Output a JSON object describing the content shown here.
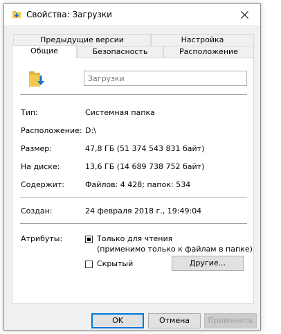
{
  "window": {
    "title": "Свойства: Загрузки",
    "accent_color": "#0078d7"
  },
  "tabs": {
    "row_top": [
      "Предыдущие версии",
      "Настройка"
    ],
    "row_bottom": [
      "Общие",
      "Безопасность",
      "Расположение"
    ],
    "active": "Общие"
  },
  "general": {
    "name_placeholder": "Загрузки",
    "type_label": "Тип:",
    "type_value": "Системная папка",
    "location_label": "Расположение:",
    "location_value": "D:\\",
    "size_label": "Размер:",
    "size_value": "47,8 ГБ (51 374 543 831 байт)",
    "disk_label": "На диске:",
    "disk_value": "13,6 ГБ (14 689 738 752 байт)",
    "contains_label": "Содержит:",
    "contains_value": "Файлов: 4 428; папок: 534",
    "created_label": "Создан:",
    "created_value": "24 февраля 2018 г., 19:49:04",
    "attributes_label": "Атрибуты:",
    "readonly_label": "Только для чтения",
    "readonly_note": "(применимо только к файлам в папке)",
    "hidden_label": "Скрытый",
    "other_button": "Другие..."
  },
  "footer": {
    "ok": "OK",
    "cancel": "Отмена",
    "apply": "Применить"
  }
}
